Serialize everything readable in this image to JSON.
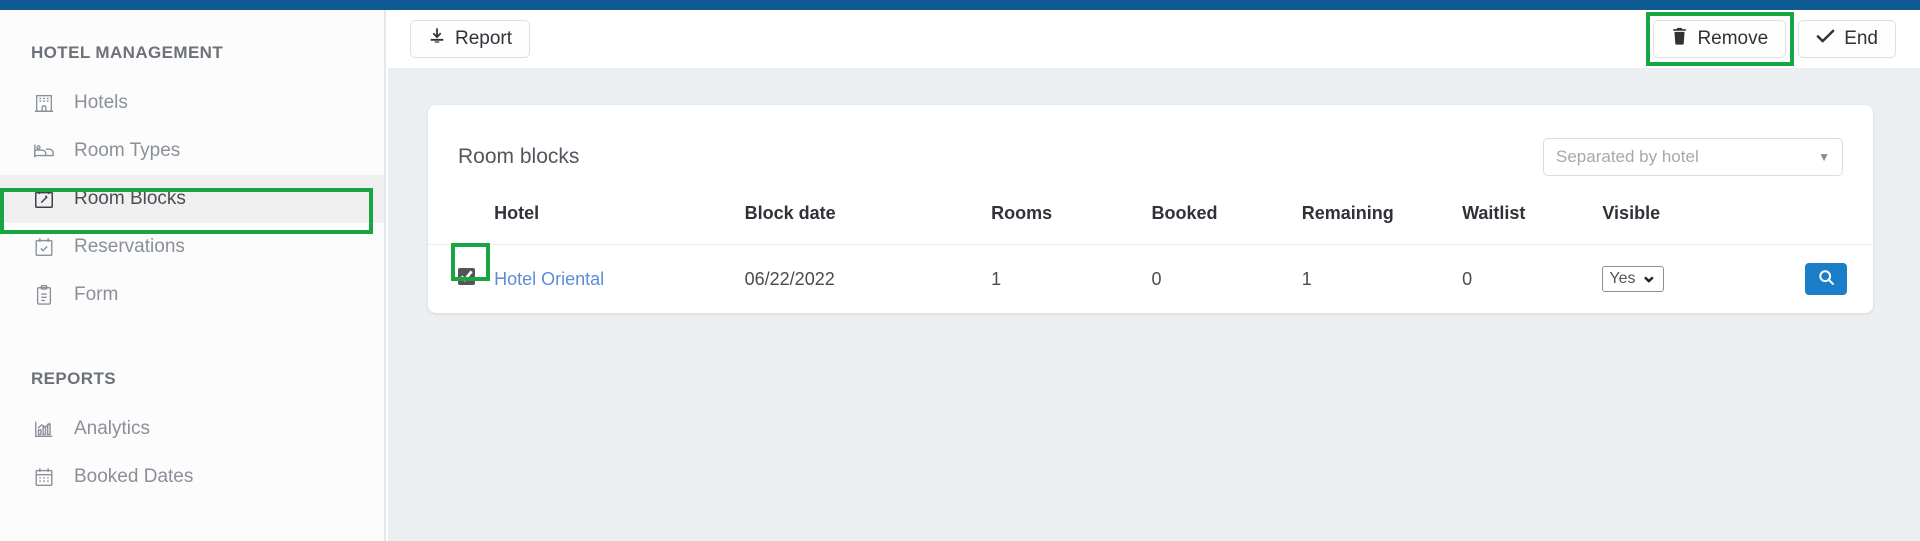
{
  "theme": {
    "topbar_color": "#0d5b92",
    "accent_blue": "#1a7fc8",
    "highlight_green": "#18a644",
    "link_blue": "#5a8dd6",
    "content_bg": "#eceff1"
  },
  "sidebar": {
    "groups": [
      {
        "title": "HOTEL MANAGEMENT",
        "items": [
          {
            "label": "Hotels",
            "icon": "hotel-building-icon",
            "active": false
          },
          {
            "label": "Room Types",
            "icon": "bed-icon",
            "active": false
          },
          {
            "label": "Room Blocks",
            "icon": "calendar-edit-icon",
            "active": true
          },
          {
            "label": "Reservations",
            "icon": "calendar-check-icon",
            "active": false
          },
          {
            "label": "Form",
            "icon": "clipboard-list-icon",
            "active": false
          }
        ]
      },
      {
        "title": "REPORTS",
        "items": [
          {
            "label": "Analytics",
            "icon": "bar-chart-icon",
            "active": false
          },
          {
            "label": "Booked Dates",
            "icon": "calendar-grid-icon",
            "active": false
          }
        ]
      }
    ]
  },
  "toolbar": {
    "report_label": "Report",
    "report_icon": "download-icon",
    "remove_label": "Remove",
    "remove_icon": "trash-icon",
    "end_label": "End",
    "end_icon": "check-icon"
  },
  "card": {
    "title": "Room blocks",
    "grouping_select": {
      "value": "Separated by hotel",
      "caret_icon": "chevron-down-icon"
    },
    "table": {
      "columns": [
        "Hotel",
        "Block date",
        "Rooms",
        "Booked",
        "Remaining",
        "Waitlist",
        "Visible"
      ],
      "rows": [
        {
          "selected": true,
          "hotel": "Hotel Oriental",
          "block_date": "06/22/2022",
          "rooms": "1",
          "booked": "0",
          "remaining": "1",
          "waitlist": "0",
          "visible": "Yes",
          "action_icon": "search-icon"
        }
      ]
    }
  },
  "annotations": {
    "highlighted_nav_item": "Room Blocks",
    "highlighted_button": "Remove",
    "highlighted_checkbox": "row-select-checkbox"
  }
}
